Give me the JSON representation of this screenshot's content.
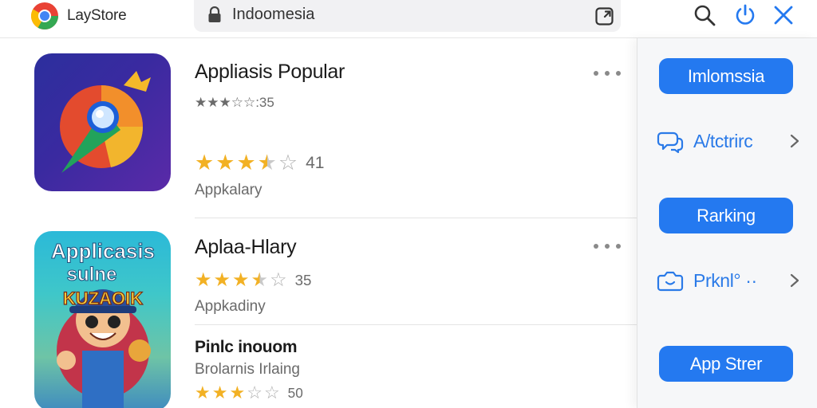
{
  "header": {
    "brand_name": "LayStore",
    "address_text": "Indoomesia",
    "icons": [
      "browser-logo-icon",
      "lock-icon",
      "share-icon",
      "search-icon",
      "power-icon",
      "close-icon"
    ]
  },
  "apps": [
    {
      "title": "Appliasis Popular",
      "top_rating_text": "★★★☆☆:35",
      "rating_value": "41",
      "rating_stars": 3.5,
      "subtitle": "Appkalary"
    },
    {
      "title": "Aplaa-Hlary",
      "rating_value": "35",
      "rating_stars": 3.5,
      "subtitle": "Appkadiny",
      "icon_caption_line1": "Applicasis",
      "icon_caption_line2": "sulne",
      "icon_caption_line3": "KUZAOIK"
    },
    {
      "title": "Pinlc inouom",
      "subtitle": "Brolarnis Irlaing",
      "rating_value": "50",
      "rating_stars": 3
    }
  ],
  "sidebar": {
    "buttons": [
      "Imlomssia",
      "Rarking",
      "App Strer"
    ],
    "links": [
      {
        "label": "A/tctrirc",
        "icon": "chat-icon"
      },
      {
        "label": "Prknl° ··",
        "icon": "camera-icon"
      }
    ]
  },
  "colors": {
    "accent": "#2479f0",
    "star_gold": "#f2b124",
    "star_grey": "#7b7b7b",
    "link_blue": "#2a7ae8"
  }
}
